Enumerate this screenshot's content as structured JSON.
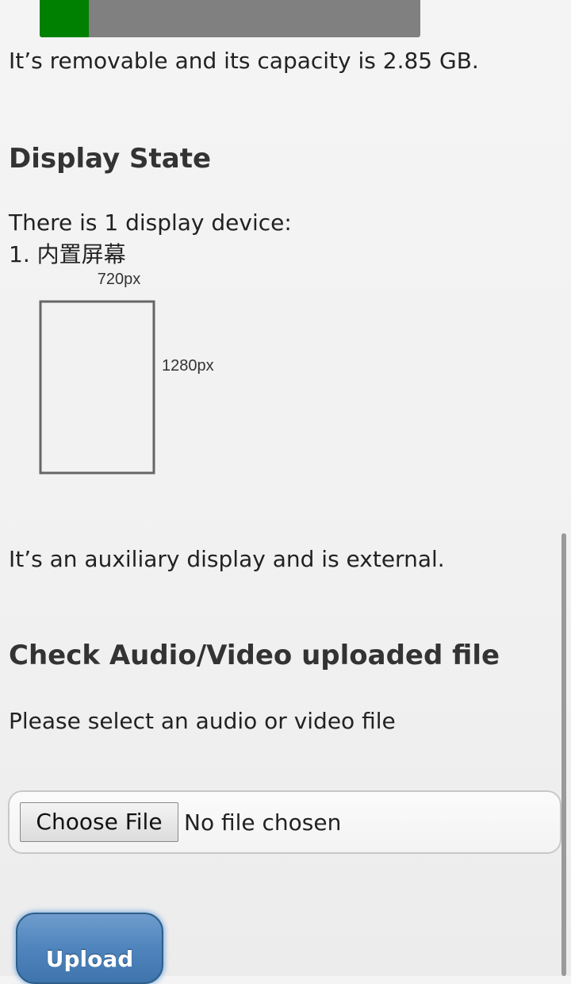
{
  "storage": {
    "used_fraction": 0.13,
    "bar_fill_color": "#008000",
    "bar_track_color": "#808080",
    "description": "It’s removable and its capacity is 2.85 GB."
  },
  "display_state": {
    "heading": "Display State",
    "count_text": "There is 1 display device:",
    "device_name": "1. 内置屏幕",
    "width_label": "720px",
    "height_label": "1280px",
    "description": "It’s an auxiliary display and is external."
  },
  "av_check": {
    "heading": "Check Audio/Video uploaded file",
    "instruction": "Please select an audio or video file",
    "choose_file_label": "Choose File",
    "file_status": "No file chosen",
    "upload_label": "Upload"
  }
}
